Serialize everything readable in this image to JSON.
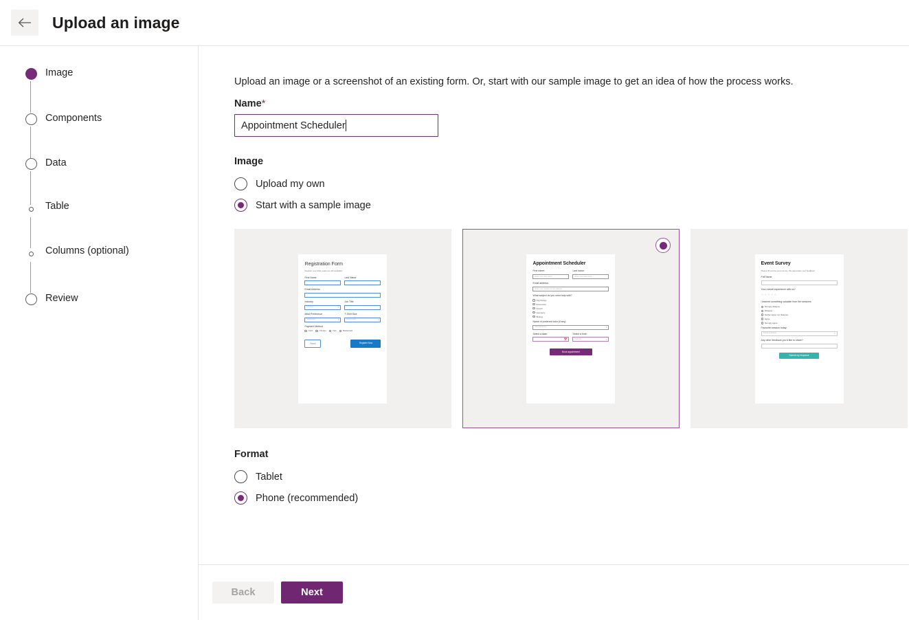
{
  "header": {
    "back_icon": "arrow-left-icon",
    "title": "Upload an image"
  },
  "sidebar": {
    "steps": [
      {
        "label": "Image",
        "state": "active",
        "type": "major"
      },
      {
        "label": "Components",
        "state": "pending",
        "type": "major"
      },
      {
        "label": "Data",
        "state": "pending",
        "type": "major"
      },
      {
        "label": "Table",
        "state": "pending",
        "type": "minor"
      },
      {
        "label": "Columns (optional)",
        "state": "pending",
        "type": "minor"
      },
      {
        "label": "Review",
        "state": "pending",
        "type": "major"
      }
    ]
  },
  "main": {
    "intro": "Upload an image or a screenshot of an existing form. Or, start with our sample image to get an idea of how the process works.",
    "name_label": "Name",
    "name_required_mark": "*",
    "name_value": "Appointment Scheduler",
    "image_section_title": "Image",
    "image_options": [
      {
        "label": "Upload my own",
        "selected": false
      },
      {
        "label": "Start with a sample image",
        "selected": true
      }
    ],
    "format_section_title": "Format",
    "format_options": [
      {
        "label": "Tablet",
        "selected": false
      },
      {
        "label": "Phone (recommended)",
        "selected": true
      }
    ],
    "carousel": {
      "prev_icon": "chevron-left-icon",
      "next_icon": "chevron-right-icon",
      "cards": [
        {
          "id": "registration-form",
          "selected": false,
          "title": "Registration Form",
          "subtitle": "Register now while seats are still available!",
          "fields": {
            "first_name_label": "First Name",
            "last_name_label": "Last Name",
            "email_label": "Email Address",
            "industry_label": "Industry",
            "industry_value": "Finance",
            "job_title_label": "Job Title",
            "meal_label": "Meal Preference",
            "meal_value": "Vegetarian",
            "tshirt_label": "T-Shirt Size",
            "tshirt_value": "Extra small",
            "payment_label": "Payment Method",
            "payment_options": [
              "Cash",
              "Cheque",
              "Visa",
              "Mastercard"
            ],
            "reset_button": "Reset",
            "submit_button": "Register Now"
          }
        },
        {
          "id": "appointment-scheduler",
          "selected": true,
          "title": "Appointment Scheduler",
          "fields": {
            "first_name_label": "First name:",
            "first_name_placeholder": "Enter your first name",
            "last_name_label": "Last name:",
            "last_name_placeholder": "Enter your last name",
            "email_label": "Email address:",
            "email_placeholder": "Enter your student email address",
            "subject_label": "What subject do you need help with?",
            "subject_options": [
              "Psychology",
              "Economics",
              "French",
              "Geometry",
              "Biology"
            ],
            "tutor_label": "Name of preferred tutor (if any)",
            "tutor_value": "No preference",
            "date_label": "Select a date:",
            "time_label": "Select a time:",
            "time_value": "9:00 AM",
            "calendar_icon": "calendar-icon",
            "submit_button": "Book appointment"
          }
        },
        {
          "id": "event-survey",
          "selected": false,
          "title": "Event Survey",
          "subtitle": "Please fill out the event survey. We appreciate your feedback.",
          "fields": {
            "full_name_label": "Full Name",
            "experience_label": "Your overall experience with us?",
            "stars": "☆☆☆☆☆",
            "likert_label": "I learned something valuable from the sessions",
            "likert_options": [
              "Strongly disagree",
              "Disagree",
              "Neither agree nor disagree",
              "Agree",
              "Strongly agree"
            ],
            "session_label": "Favourite session today:",
            "session_value": "Select a session",
            "feedback_label": "Any other feedback you'd like to share?",
            "submit_button": "Submit my response"
          }
        }
      ]
    }
  },
  "footer": {
    "back_label": "Back",
    "next_label": "Next"
  },
  "colors": {
    "accent_purple": "#702670",
    "step_active": "#772a77",
    "card_border": "#9b4f96",
    "arrow_bg": "#9b4f96",
    "card_bg": "#f1f0ef",
    "register_blue": "#167ac6",
    "submit_teal": "#38b2ac"
  }
}
